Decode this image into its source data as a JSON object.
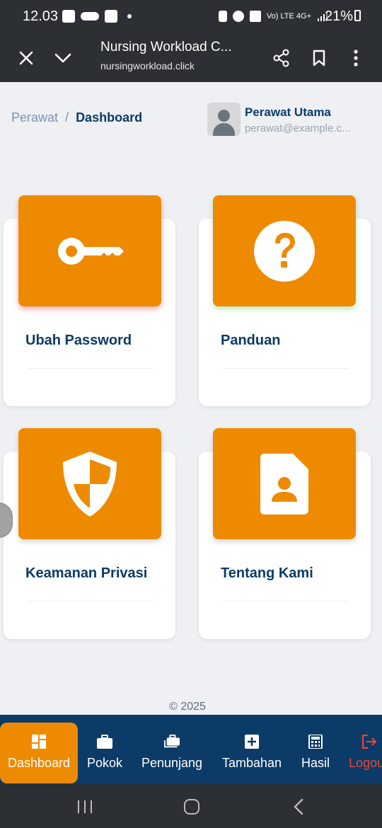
{
  "status_bar": {
    "time": "12.03",
    "network": "Vo) LTE 4G+",
    "battery": "21%"
  },
  "browser": {
    "title": "Nursing Workload C...",
    "url": "nursingworkload.click",
    "icons": [
      "close-icon",
      "chevron-down-icon",
      "share-icon",
      "bookmark-icon",
      "more-vert-icon"
    ]
  },
  "breadcrumb": {
    "parent": "Perawat",
    "separator": "/",
    "current": "Dashboard"
  },
  "user": {
    "name": "Perawat Utama",
    "email": "perawat@example.c..."
  },
  "cards": [
    {
      "label": "Ubah Password",
      "icon": "key-icon"
    },
    {
      "label": "Panduan",
      "icon": "question-icon"
    },
    {
      "label": "Keamanan Privasi",
      "icon": "shield-icon"
    },
    {
      "label": "Tentang Kami",
      "icon": "contact-card-icon"
    }
  ],
  "footer": {
    "copyright": "© 2025"
  },
  "bottom_nav": [
    {
      "label": "Dashboard",
      "icon": "dashboard-icon",
      "active": true
    },
    {
      "label": "Pokok",
      "icon": "briefcase-icon"
    },
    {
      "label": "Penunjang",
      "icon": "briefcases-icon"
    },
    {
      "label": "Tambahan",
      "icon": "plus-square-icon"
    },
    {
      "label": "Hasil",
      "icon": "calculator-icon"
    },
    {
      "label": "Logou",
      "icon": "logout-icon"
    }
  ],
  "colors": {
    "accent": "#ee8a00",
    "primary": "#0b3b66",
    "background": "#eef0f4",
    "logout": "#e8453c"
  }
}
